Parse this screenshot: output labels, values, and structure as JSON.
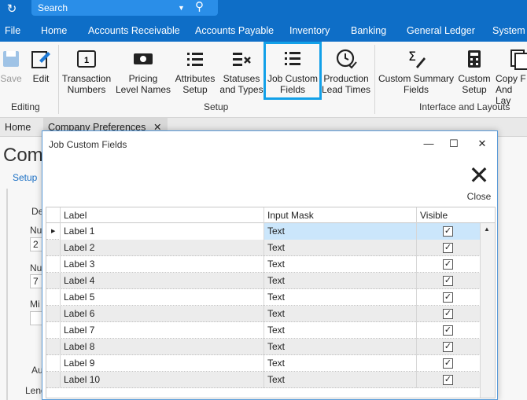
{
  "topbar": {
    "app_icon": "refresh-icon",
    "search_label": "Search"
  },
  "menu": [
    "File",
    "Home",
    "Accounts Receivable",
    "Accounts Payable",
    "Inventory",
    "Banking",
    "General Ledger",
    "System"
  ],
  "ribbon": {
    "save": "Save",
    "edit": "Edit",
    "editing_group": "Editing",
    "transaction_numbers": [
      "Transaction",
      "Numbers"
    ],
    "pricing_level_names": [
      "Pricing",
      "Level Names"
    ],
    "attributes_setup": [
      "Attributes",
      "Setup"
    ],
    "statuses_and_types": [
      "Statuses",
      "and Types"
    ],
    "job_custom_fields": [
      "Job Custom",
      "Fields"
    ],
    "production_lead_times": [
      "Production",
      "Lead Times"
    ],
    "setup_group": "Setup",
    "custom_summary_fields": [
      "Custom Summary",
      "Fields"
    ],
    "custom_setup": [
      "Custom",
      "Setup"
    ],
    "copy_fields": [
      "Copy F",
      "And Lay"
    ],
    "interface_group": "Interface and Layouts"
  },
  "tabs": {
    "home": "Home",
    "company_preferences": "Company Preferences",
    "close_glyph": "✕"
  },
  "background": {
    "title": "Com",
    "setup_tab": "Setup",
    "de": "De",
    "nu1": "Nu",
    "val1": "2",
    "nu2": "Nu",
    "val2": "7",
    "mi": "Mi",
    "au": "Au",
    "leng": "Leng"
  },
  "dialog": {
    "title": "Job Custom Fields",
    "close_label": "Close",
    "columns": {
      "label": "Label",
      "input_mask": "Input Mask",
      "visible": "Visible"
    },
    "rows": [
      {
        "label": "Label 1",
        "mask": "Text",
        "visible": true
      },
      {
        "label": "Label 2",
        "mask": "Text",
        "visible": true
      },
      {
        "label": "Label 3",
        "mask": "Text",
        "visible": true
      },
      {
        "label": "Label 4",
        "mask": "Text",
        "visible": true
      },
      {
        "label": "Label 5",
        "mask": "Text",
        "visible": true
      },
      {
        "label": "Label 6",
        "mask": "Text",
        "visible": true
      },
      {
        "label": "Label 7",
        "mask": "Text",
        "visible": true
      },
      {
        "label": "Label 8",
        "mask": "Text",
        "visible": true
      },
      {
        "label": "Label 9",
        "mask": "Text",
        "visible": true
      },
      {
        "label": "Label 10",
        "mask": "Text",
        "visible": true
      }
    ]
  },
  "colors": {
    "accent": "#0e6ec7",
    "highlight": "#12a0e8",
    "selection": "#cbe6fb"
  }
}
